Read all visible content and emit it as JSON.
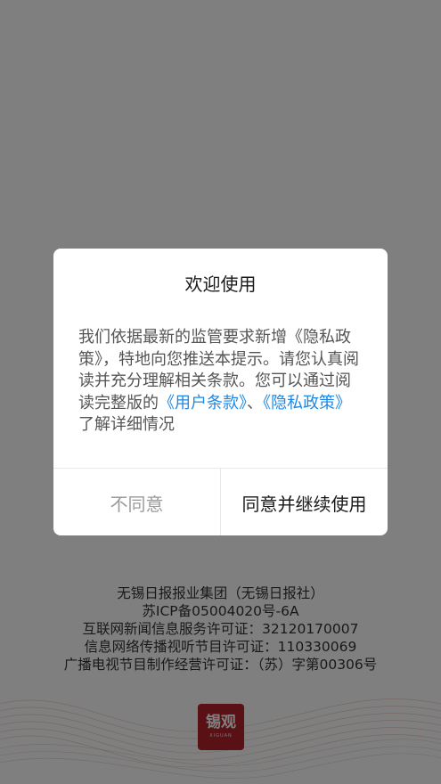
{
  "dialog": {
    "title": "欢迎使用",
    "body_text_1": "我们依据最新的监管要求新增《隐私政策》，特地向您推送本提示。请您认真阅读并充分理解相关条款。您可以通过阅读完整版的",
    "user_terms_link": "《用户条款》",
    "separator": "、",
    "privacy_link": "《隐私政策》",
    "body_text_2": "了解详细情况",
    "disagree_label": "不同意",
    "agree_label": "同意并继续使用"
  },
  "footer": {
    "lines": [
      "无锡日报报业集团（无锡日报社）",
      "苏ICP备05004020号-6A",
      "互联网新闻信息服务许可证：32120170007",
      "信息网络传播视听节目许可证：110330069",
      "广播电视节目制作经营许可证：（苏）字第00306号"
    ]
  },
  "logo": {
    "text": "锡观",
    "subtext": "XIGUAN"
  },
  "colors": {
    "link": "#1e88e5",
    "logo_bg": "#b3232b",
    "overlay": "rgba(0,0,0,0.5)"
  }
}
